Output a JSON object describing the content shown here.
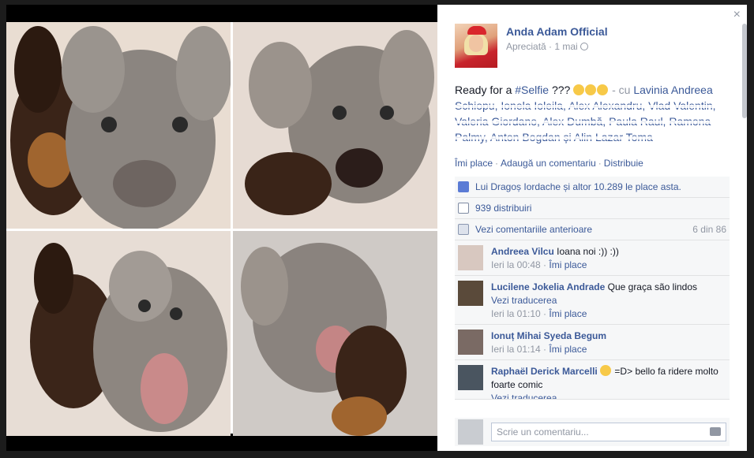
{
  "post": {
    "page_name": "Anda Adam Official",
    "status": "Apreciată",
    "separator": " · ",
    "date": "1 mai",
    "text_intro": "Ready for a ",
    "hashtag": "#Selfie",
    "text_after": " ??? ",
    "with_prefix": " - cu ",
    "tagged_people": "Lavinia Andreea Schiopu, Ionela Ioleila, Alex Alexandru, Vlad Valentin, Valeria Giordano, Alex Dumbă, Paula Raul, Ramona Palmy, Anton Bogdan și Alin Lazar Toma"
  },
  "actions": {
    "like": "Îmi place",
    "comment": "Adaugă un comentariu",
    "share": "Distribuie",
    "separator": "·"
  },
  "stats": {
    "likes_text": "Lui Dragoș Iordache și altor 10.289 le place asta.",
    "shares_text": "939 distribuiri",
    "prev_comments": "Vezi comentariile anterioare",
    "comments_count": "6 din 86"
  },
  "comments": [
    {
      "author": "Andreea Vilcu",
      "text": "Ioana noi :)) :))",
      "time": "Ieri la 00:48",
      "like": "Îmi place",
      "translate": ""
    },
    {
      "author": "Lucilene Jokelia Andrade",
      "text": "Que graça são lindos",
      "time": "Ieri la 01:10",
      "like": "Îmi place",
      "translate": "Vezi traducerea"
    },
    {
      "author": "Ionuț Mihai",
      "text": "Syeda Begum",
      "time": "Ieri la 01:14",
      "like": "Îmi place",
      "translate": ""
    },
    {
      "author": "Raphaël Derick Marcelli",
      "text": "=D> bello fa ridere molto foarte comic",
      "time": "",
      "like": "",
      "translate": "Vezi traducerea"
    }
  ],
  "composer": {
    "placeholder": "Scrie un comentariu..."
  },
  "window": {
    "close": "×"
  },
  "colors": {
    "link": "#3b5998",
    "muted": "#9197a3",
    "panel_bg": "#f6f7f8"
  }
}
